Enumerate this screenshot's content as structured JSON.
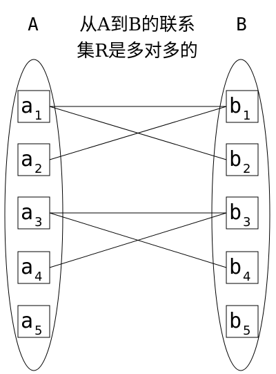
{
  "title": {
    "set_a_label": "A",
    "set_b_label": "B",
    "line1": "从A到B的联系",
    "line2": "集R是多对多的"
  },
  "set_a": {
    "name": "A",
    "elements": [
      {
        "base": "a",
        "sub": "1"
      },
      {
        "base": "a",
        "sub": "2"
      },
      {
        "base": "a",
        "sub": "3"
      },
      {
        "base": "a",
        "sub": "4"
      },
      {
        "base": "a",
        "sub": "5"
      }
    ]
  },
  "set_b": {
    "name": "B",
    "elements": [
      {
        "base": "b",
        "sub": "1"
      },
      {
        "base": "b",
        "sub": "2"
      },
      {
        "base": "b",
        "sub": "3"
      },
      {
        "base": "b",
        "sub": "4"
      },
      {
        "base": "b",
        "sub": "5"
      }
    ]
  },
  "relationships": [
    {
      "from": "a1",
      "to": "b1"
    },
    {
      "from": "a1",
      "to": "b2"
    },
    {
      "from": "a2",
      "to": "b1"
    },
    {
      "from": "a3",
      "to": "b3"
    },
    {
      "from": "a3",
      "to": "b4"
    },
    {
      "from": "a4",
      "to": "b3"
    }
  ]
}
